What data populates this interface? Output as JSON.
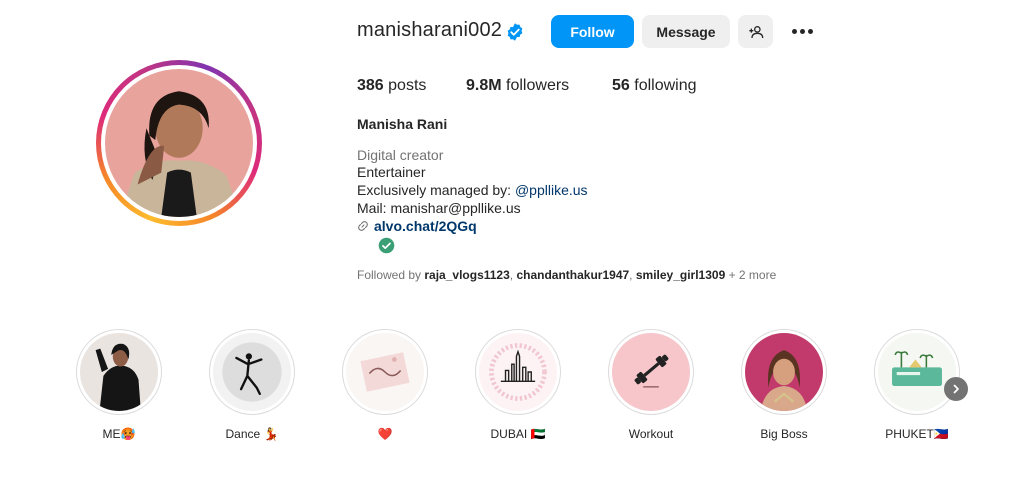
{
  "profile": {
    "username": "manisharani002",
    "full_name": "Manisha Rani",
    "verified": true,
    "buttons": {
      "follow": "Follow",
      "message": "Message"
    },
    "stats": {
      "posts_count": "386",
      "posts_label": "posts",
      "followers_count": "9.8M",
      "followers_label": "followers",
      "following_count": "56",
      "following_label": "following"
    },
    "bio": {
      "category": "Digital creator",
      "line1": "Entertainer",
      "line2_prefix": "Exclusively managed by: ",
      "line2_mention": "@ppllike.us",
      "line3": "Mail: manishar@ppllike.us",
      "link": "alvo.chat/2QGq"
    },
    "followed_by": {
      "prefix": "Followed by ",
      "users": [
        "raja_vlogs1123",
        "chandanthakur1947",
        "smiley_girl1309"
      ],
      "more": " + 2 more"
    }
  },
  "highlights": [
    {
      "label": "ME🥵"
    },
    {
      "label": "Dance 💃"
    },
    {
      "label": "❤️"
    },
    {
      "label": "DUBAI 🇦🇪"
    },
    {
      "label": "Workout"
    },
    {
      "label": "Big Boss"
    },
    {
      "label": "PHUKET🇵🇭"
    }
  ],
  "colors": {
    "accent": "#0095f6",
    "link": "#00376b",
    "muted": "#737373",
    "verified": "#0095f6",
    "check_badge": "#3a9f74"
  },
  "icons": [
    "verified-badge-icon",
    "add-user-icon",
    "more-options-icon",
    "link-icon",
    "check-icon",
    "chevron-right-icon"
  ]
}
